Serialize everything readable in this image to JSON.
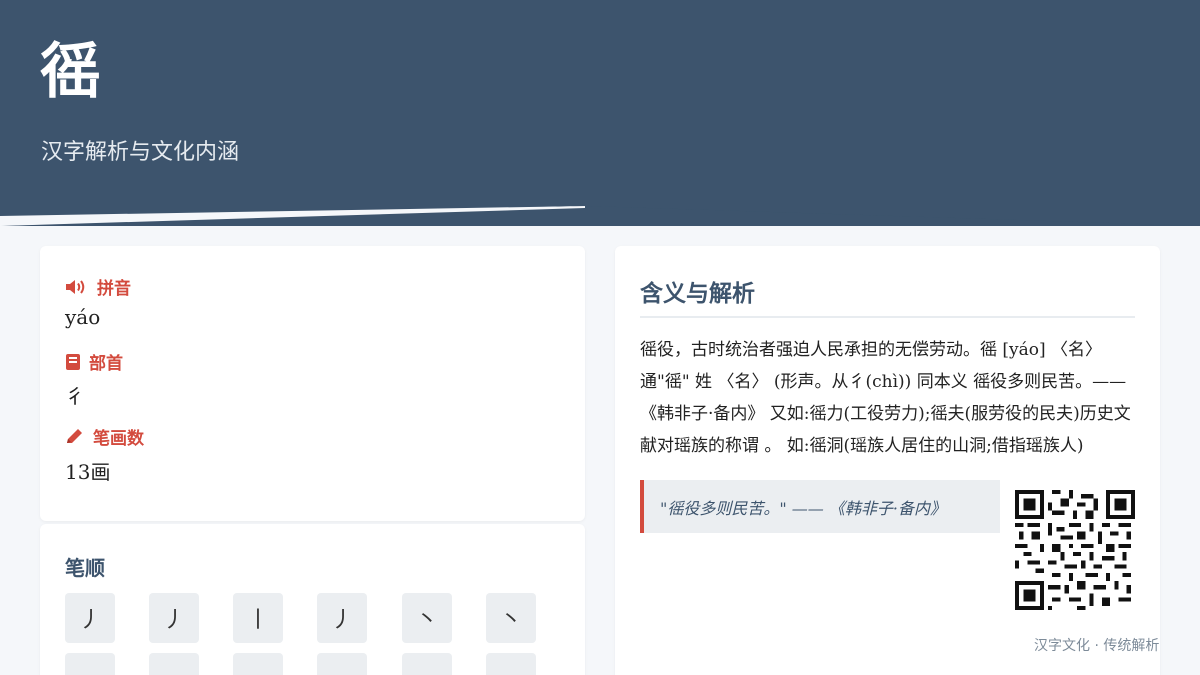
{
  "header": {
    "character": "徭",
    "subtitle": "汉字解析与文化内涵"
  },
  "info": {
    "pinyin_label": "拼音",
    "pinyin_value": "yáo",
    "radical_label": "部首",
    "radical_value": "彳",
    "strokes_label": "笔画数",
    "strokes_value": "13画"
  },
  "stroke_order": {
    "title": "笔顺",
    "strokes": [
      "丿",
      "丿",
      "丨",
      "丿",
      "丶",
      "丶",
      "",
      "",
      "",
      "",
      "",
      ""
    ]
  },
  "meaning": {
    "title": "含义与解析",
    "text": "徭役，古时统治者强迫人民承担的无偿劳动。徭 [yáo] 〈名〉通\"徭\" 姓 〈名〉 (形声。从彳(chì)) 同本义 徭役多则民苦。——《韩非子·备内》 又如:徭力(工役劳力);徭夫(服劳役的民夫)历史文献对瑶族的称谓 。 如:徭洞(瑶族人居住的山洞;借指瑶族人)",
    "quote": "\"徭役多则民苦。\" —— 《韩非子·备内》"
  },
  "footer": {
    "note": "汉字文化 · 传统解析"
  },
  "colors": {
    "header_bg": "#3d546d",
    "accent": "#d34b3e",
    "page_bg": "#f5f7fa"
  }
}
